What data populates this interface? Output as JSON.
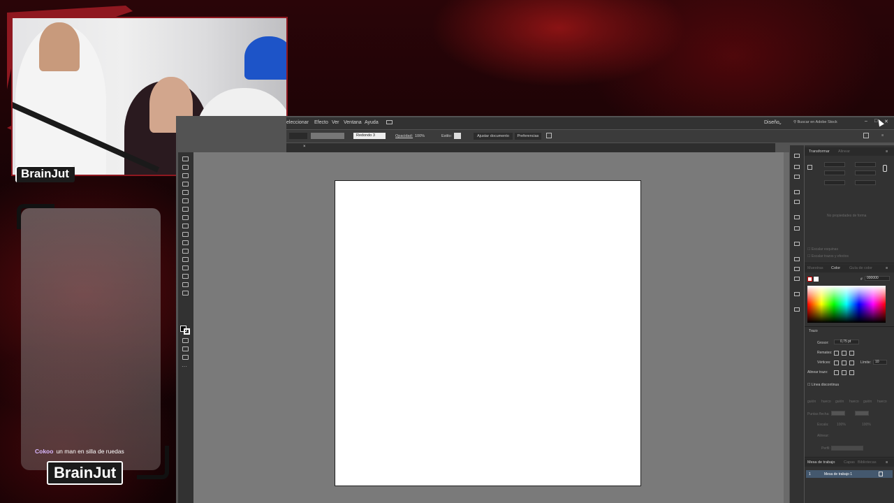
{
  "overlay": {
    "brand_top": "BrainJut",
    "brand_bottom": "BrainJut",
    "chat": {
      "user": "Cokoo",
      "message": "un man en silla de ruedas"
    },
    "colors": {
      "accent_red": "#8f1820",
      "bg_dark": "#140406"
    }
  },
  "illustrator": {
    "menu": [
      "eleccionar",
      "Efecto",
      "Ver",
      "Ventana",
      "Ayuda"
    ],
    "workspace": "Diseño",
    "search_placeholder": "Buscar en Adobe Stock",
    "control": {
      "brush": "Redondo 3",
      "opacity_label": "Opacidad:",
      "opacity_value": "100%",
      "style_label": "Estilo:",
      "align_doc_button": "Ajustar documento",
      "prefs_button": "Preferencias"
    },
    "panels": {
      "transform_tabs": [
        "Transformar",
        "Alinear"
      ],
      "no_properties": "No propiedades de forma",
      "scale_corners": "Escalar esquinas",
      "scale_strokes": "Escalar trazos y efectos",
      "color_tabs": [
        "Muestras",
        "Color",
        "Guía de color"
      ],
      "hex_prefix": "#",
      "hex_value": "000000",
      "stroke": {
        "title": "Trazo",
        "weight_label": "Grosor:",
        "weight_value": "0,75 pt",
        "cap_label": "Remates:",
        "corner_label": "Vértices:",
        "limit_label": "Límite:",
        "limit_value": "10",
        "align_label": "Alinear trazo:",
        "dashed_label": "Línea discontinua",
        "dash_labels": [
          "guión",
          "hueco",
          "guión",
          "hueco",
          "guión",
          "hueco"
        ],
        "arrowheads_label": "Puntas flecha:",
        "scale_label": "Escala:",
        "scale_value_a": "100%",
        "scale_value_b": "100%",
        "align_arrow_label": "Alinear:",
        "profile_label": "Perfil:"
      },
      "artboard_tabs": [
        "Mesa de trabajo",
        "Capas",
        "Bibliotecas"
      ],
      "artboard_row": {
        "index": "1",
        "name": "Mesa de trabajo 1"
      }
    }
  }
}
